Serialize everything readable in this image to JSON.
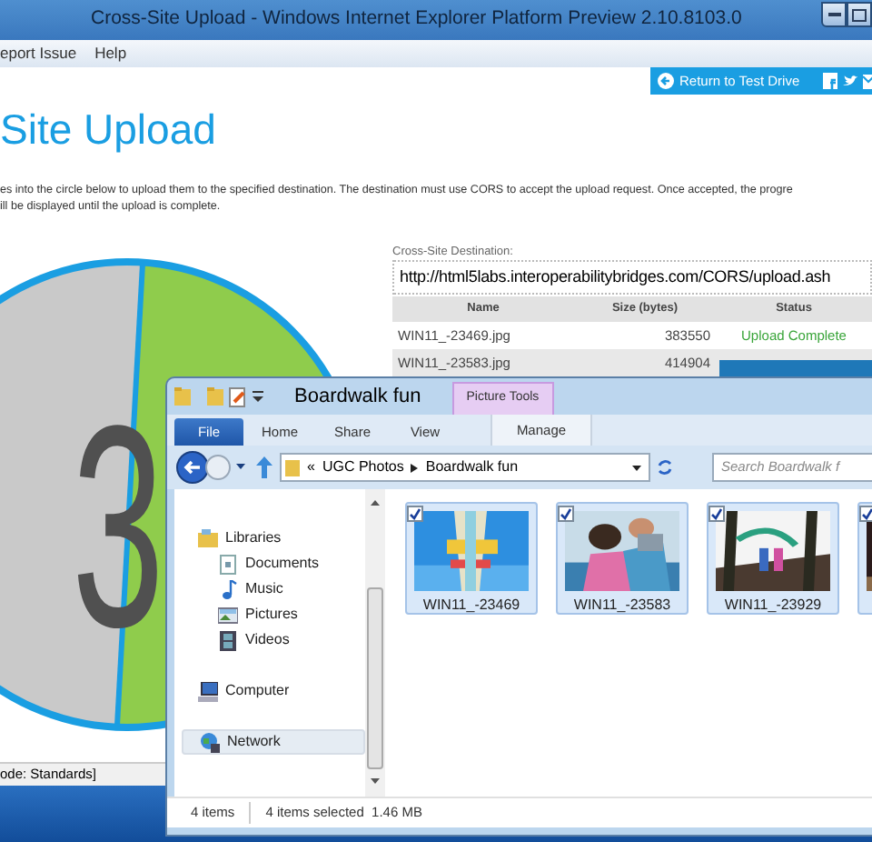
{
  "window": {
    "title": "Cross-Site Upload - Windows Internet Explorer Platform Preview 2.10.8103.0"
  },
  "menu": [
    "eport Issue",
    "Help"
  ],
  "return_link": "Return to Test Drive",
  "heading": "Site Upload",
  "description_lines": [
    "es into the circle below to upload them to the specified destination. The destination must use CORS to accept the upload request. Once accepted, the progre",
    "ill be displayed until the upload is complete."
  ],
  "drop_circle": {
    "count": "3"
  },
  "destination": {
    "label": "Cross-Site Destination:",
    "value": "http://html5labs.interoperabilitybridges.com/CORS/upload.ash"
  },
  "uploads": {
    "columns": [
      "Name",
      "Size (bytes)",
      "Status"
    ],
    "rows": [
      {
        "name": "WIN11_-23469.jpg",
        "size": "383550",
        "kind": "complete",
        "status": "Upload Complete"
      },
      {
        "name": "WIN11_-23583.jpg",
        "size": "414904",
        "kind": "progress",
        "level": 1
      }
    ]
  },
  "status_bar": "ode: Standards]",
  "explorer": {
    "title": "Boardwalk fun",
    "context_tab": "Picture Tools",
    "tabs": [
      {
        "label": "File",
        "kind": "file"
      },
      {
        "label": "Home",
        "kind": "tab"
      },
      {
        "label": "Share",
        "kind": "tab"
      },
      {
        "label": "View",
        "kind": "tab"
      },
      {
        "label": "Manage",
        "kind": "context"
      }
    ],
    "breadcrumb_overflow": "«",
    "breadcrumb": [
      "UGC Photos",
      "Boardwalk fun"
    ],
    "search": {
      "placeholder": "Search Boardwalk f"
    },
    "nav": [
      {
        "label": "Libraries",
        "kind": "libraries",
        "selected": false,
        "children": [
          {
            "label": "Documents",
            "kind": "documents",
            "selected": false
          },
          {
            "label": "Music",
            "kind": "music",
            "selected": false
          },
          {
            "label": "Pictures",
            "kind": "pictures",
            "selected": false
          },
          {
            "label": "Videos",
            "kind": "videos",
            "selected": false
          }
        ]
      },
      {
        "label": "Computer",
        "kind": "computer",
        "selected": false
      },
      {
        "label": "Network",
        "kind": "network",
        "selected": true
      }
    ],
    "files": [
      {
        "name": "WIN11_-23469",
        "checked": true,
        "selected": true
      },
      {
        "name": "WIN11_-23583",
        "checked": true,
        "selected": true
      },
      {
        "name": "WIN11_-23929",
        "checked": true,
        "selected": true
      },
      {
        "checked": true,
        "selected": true
      }
    ],
    "status": [
      "4 items",
      "4 items selected  1.46 MB"
    ]
  }
}
